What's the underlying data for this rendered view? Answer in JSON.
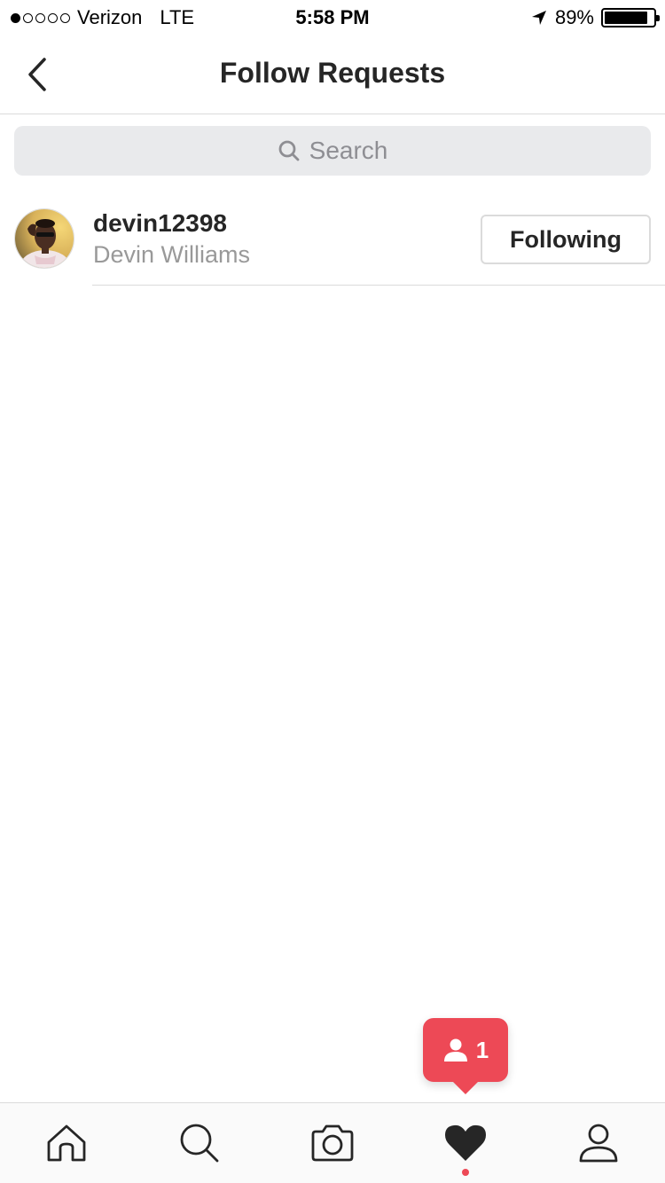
{
  "status_bar": {
    "carrier": "Verizon",
    "network": "LTE",
    "time": "5:58 PM",
    "battery_percent": "89%",
    "battery_level": 0.89,
    "signal_bars_filled": 1,
    "signal_bars_total": 5
  },
  "header": {
    "title": "Follow Requests",
    "back_icon": "chevron-left-icon"
  },
  "search": {
    "placeholder": "Search"
  },
  "requests": [
    {
      "username": "devin12398",
      "full_name": "Devin Williams",
      "action_label": "Following"
    }
  ],
  "activity_tooltip": {
    "icon": "person-icon",
    "count": "1"
  },
  "tab_bar": {
    "tabs": [
      {
        "icon": "home-icon",
        "active": false
      },
      {
        "icon": "search-icon",
        "active": false
      },
      {
        "icon": "camera-icon",
        "active": false
      },
      {
        "icon": "heart-icon",
        "active": true
      },
      {
        "icon": "profile-icon",
        "active": false
      }
    ]
  },
  "colors": {
    "accent": "#ed4956",
    "text_primary": "#262626",
    "text_secondary": "#999999",
    "border": "#dbdbdb",
    "search_bg": "#e9eaec"
  }
}
